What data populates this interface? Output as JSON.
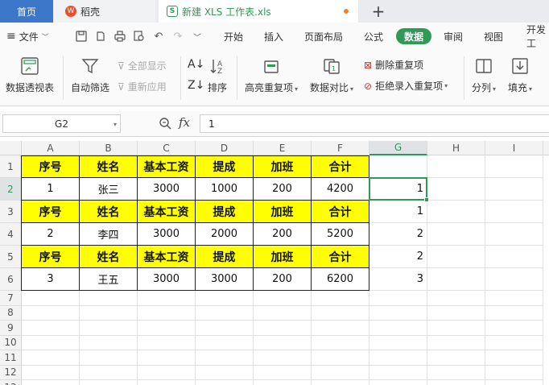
{
  "tabs": {
    "home": "首页",
    "wps": "稻壳",
    "file": "新建 XLS 工作表.xls",
    "new_tab": "+"
  },
  "menu": {
    "file": "文件",
    "items": [
      "开始",
      "插入",
      "页面布局",
      "公式",
      "数据",
      "审阅",
      "视图",
      "开发工"
    ],
    "active": "数据"
  },
  "ribbon": {
    "pivot": "数据透视表",
    "auto_filter": "自动筛选",
    "show_all": "全部显示",
    "reapply": "重新应用",
    "sort": "排序",
    "highlight_dup": "高亮重复项",
    "compare": "数据对比",
    "remove_dup": "删除重复项",
    "reject_dup": "拒绝录入重复项",
    "split": "分列",
    "fill": "填充"
  },
  "formula_bar": {
    "name_box": "G2",
    "fx": "fx",
    "value": "1"
  },
  "columns": [
    "A",
    "B",
    "C",
    "D",
    "E",
    "F",
    "G",
    "H",
    "I"
  ],
  "active_column": "G",
  "rows": [
    "1",
    "2",
    "3",
    "4",
    "5",
    "6",
    "7",
    "8",
    "9",
    "10",
    "11",
    "12",
    "13"
  ],
  "active_row": "2",
  "table": {
    "header": [
      "序号",
      "姓名",
      "基本工资",
      "提成",
      "加班",
      "合计"
    ],
    "records": [
      [
        "1",
        "张三",
        "3000",
        "1000",
        "200",
        "4200"
      ],
      [
        "2",
        "李四",
        "3000",
        "2000",
        "200",
        "5200"
      ],
      [
        "3",
        "王五",
        "3000",
        "3000",
        "200",
        "6200"
      ]
    ],
    "g_values": [
      "",
      "1",
      "1",
      "2",
      "2",
      "3"
    ]
  },
  "colors": {
    "accent": "#2f9a57",
    "header_fill": "#ffff00",
    "home_tab": "#3d77c9"
  }
}
